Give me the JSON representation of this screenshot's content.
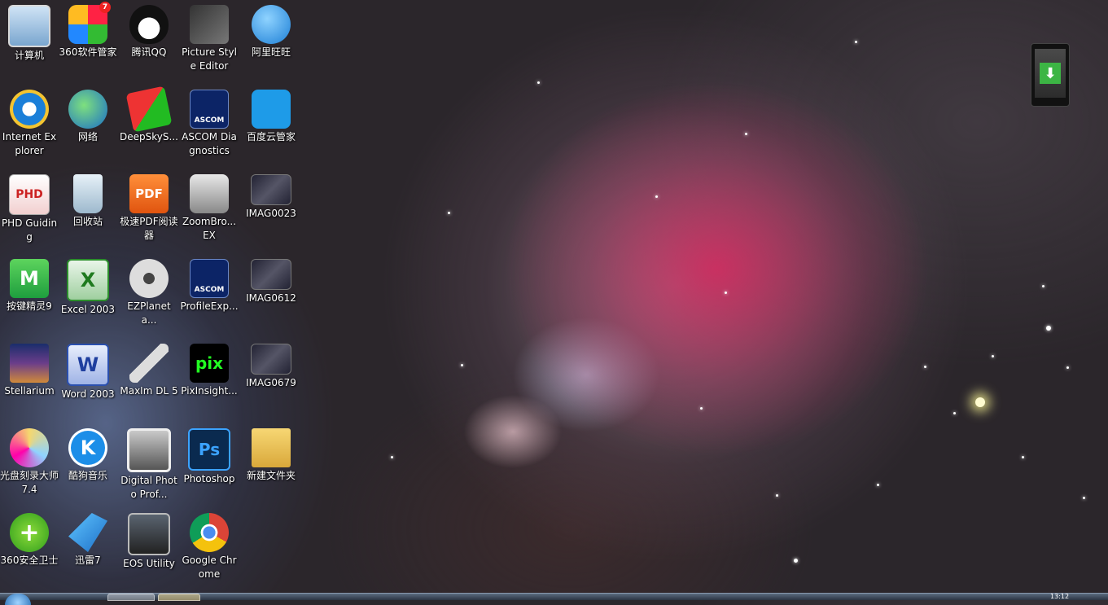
{
  "desktop": {
    "icons": [
      {
        "label": "计算机",
        "icon": "computer-icon"
      },
      {
        "label": "360软件管家",
        "icon": "360-software-manager-icon",
        "badge": "7"
      },
      {
        "label": "腾讯QQ",
        "icon": "qq-penguin-icon"
      },
      {
        "label": "Picture Style Editor",
        "icon": "picture-style-editor-icon"
      },
      {
        "label": "阿里旺旺",
        "icon": "aliwangwang-icon"
      },
      {
        "label": "Internet Explorer",
        "icon": "internet-explorer-icon"
      },
      {
        "label": "网络",
        "icon": "network-globe-icon"
      },
      {
        "label": "DeepSkyS...",
        "icon": "deepskystacker-icon"
      },
      {
        "label": "ASCOM Diagnostics",
        "icon": "ascom-icon",
        "icon_text": "ASCOM"
      },
      {
        "label": "百度云管家",
        "icon": "baidu-cloud-icon"
      },
      {
        "label": "PHD Guiding",
        "icon": "phd-guiding-icon",
        "icon_text": "PHD"
      },
      {
        "label": "回收站",
        "icon": "recycle-bin-icon"
      },
      {
        "label": "极速PDF阅读器",
        "icon": "pdf-reader-icon",
        "icon_text": "PDF"
      },
      {
        "label": "ZoomBro... EX",
        "icon": "zoombrowser-camera-icon"
      },
      {
        "label": "IMAG0023",
        "icon": "image-thumbnail-icon"
      },
      {
        "label": "按键精灵9",
        "icon": "anjian-jingling-icon",
        "icon_text": "M"
      },
      {
        "label": "Excel 2003",
        "icon": "excel-icon",
        "icon_text": "X"
      },
      {
        "label": "EZPlaneta...",
        "icon": "film-reel-icon"
      },
      {
        "label": "ProfileExp...",
        "icon": "ascom-icon",
        "icon_text": "ASCOM"
      },
      {
        "label": "IMAG0612",
        "icon": "image-thumbnail-icon"
      },
      {
        "label": "Stellarium",
        "icon": "stellarium-icon"
      },
      {
        "label": "Word 2003",
        "icon": "word-icon",
        "icon_text": "W"
      },
      {
        "label": "MaxIm DL 5",
        "icon": "telescope-icon"
      },
      {
        "label": "PixInsight...",
        "icon": "pixinsight-icon",
        "icon_text": "pix"
      },
      {
        "label": "IMAG0679",
        "icon": "image-thumbnail-icon"
      },
      {
        "label": "光盘刻录大师 7.4",
        "icon": "disc-burner-icon"
      },
      {
        "label": "酷狗音乐",
        "icon": "kugou-music-icon",
        "icon_text": "K"
      },
      {
        "label": "Digital Photo Prof...",
        "icon": "digital-photo-professional-icon"
      },
      {
        "label": "Photoshop",
        "icon": "photoshop-icon",
        "icon_text": "Ps"
      },
      {
        "label": "新建文件夹",
        "icon": "folder-icon"
      },
      {
        "label": "360安全卫士",
        "icon": "360-security-icon",
        "icon_text": "+"
      },
      {
        "label": "迅雷7",
        "icon": "xunlei-bird-icon"
      },
      {
        "label": "EOS Utility",
        "icon": "eos-utility-icon"
      },
      {
        "label": "Google Chrome",
        "icon": "chrome-icon"
      }
    ]
  },
  "widget": {
    "icon": "download-arrow-icon",
    "symbol": "⬇"
  },
  "taskbar": {
    "clock": "13:12"
  },
  "colors": {
    "nebula_pink": "#d8285f",
    "space_dark": "#2b262b",
    "download_green": "#3cb544"
  }
}
